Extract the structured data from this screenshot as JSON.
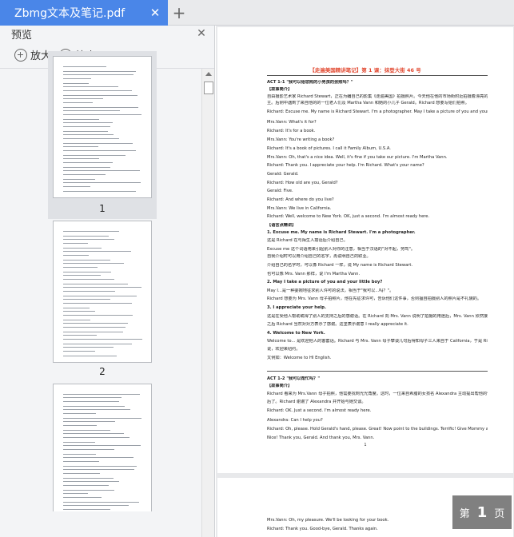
{
  "tab": {
    "title": "Zbmg文本及笔记.pdf",
    "close": "✕",
    "new": "+"
  },
  "panel": {
    "title": "预览",
    "close": "✕",
    "zoom_in": "放大",
    "zoom_out": "缩小"
  },
  "thumbnails": [
    {
      "number": "1"
    },
    {
      "number": "2"
    }
  ],
  "document": {
    "title": "【走遍美国精讲笔记】第 1 课：抹登大街 46 号",
    "page_number": "1",
    "lines": [
      {
        "text": "ACT 1-1 \"我可以给您照的小男孩的张照吗？\"",
        "style": "b"
      },
      {
        "text": "【故事简介】",
        "style": "b"
      },
      {
        "text": "自由摄影艺术家 Richard Stewart，正在为编自己的影集《走遍美国》拍摄照片。今天他在他的市场街附近拍摄着漂亮的建筑上主",
        "style": ""
      },
      {
        "text": "主。后刚中遇到了来自他的的一位老人们及 Martha Vann 和她的小儿子 Gerald。Richard 想要写给们拍照。",
        "style": ""
      },
      {
        "text": "Richard: Excuse me. My name is Richard Stewart. I'm a photographer. May I take a picture of you and your little boy?",
        "style": ""
      },
      {
        "text": "Mrs.Vann: What's it for?",
        "style": ""
      },
      {
        "text": "Richard: It's for a book.",
        "style": ""
      },
      {
        "text": "Mrs.Vann: You're writing a book?",
        "style": ""
      },
      {
        "text": "Richard: It's a book of pictures. I call it Family Album, U.S.A.",
        "style": ""
      },
      {
        "text": "Mrs.Vann: Oh, that's a nice idea. Well, it's fine if you take our picture. I'm Martha Vann.",
        "style": ""
      },
      {
        "text": "Richard: Thank you. I appreciate your help. I'm Richard. What's your name?",
        "style": ""
      },
      {
        "text": "Gerald: Gerald.",
        "style": ""
      },
      {
        "text": "Richard: How old are you, Gerald?",
        "style": ""
      },
      {
        "text": "Gerald: Five.",
        "style": ""
      },
      {
        "text": "Richard: And where do you live?",
        "style": ""
      },
      {
        "text": "Mrs.Vann: We live in California.",
        "style": ""
      },
      {
        "text": "Richard: Well, welcome to New York. OK, just a second. I'm almost ready here.",
        "style": ""
      },
      {
        "text": "【语言点精讲】",
        "style": "b"
      },
      {
        "text": "1. Excuse me. My name is Richard Stewart. I'm a photographer.",
        "style": "b"
      },
      {
        "text": "这是 Richard 在与陌生人搭话后介绍自己。",
        "style": ""
      },
      {
        "text": "Excuse me 这个词语用来引起别人对你的注意，相当于汉语的\"对不起，劳驾\"。",
        "style": ""
      },
      {
        "text": "自我介绍时可以用介绍自己的名字，再说明自己的职业。",
        "style": ""
      },
      {
        "text": "介绍自己的名字时，可以像 Richard 一样，说 My name is Richard Stewart.",
        "style": ""
      },
      {
        "text": "也可以像 Mrs. Vann 那样，说 I'm Martha Vann.",
        "style": ""
      },
      {
        "text": "2. May I take a picture of you and your little boy?",
        "style": "b"
      },
      {
        "text": "May I...是一种委婉地征求别人许可的说法，相当于\"我可以...吗？\"。",
        "style": ""
      },
      {
        "text": "Richard 想要为 Mrs. Vann 母子拍照片，他在先征求许可，告诉他们这件事，否则擅自拍摄别人的照片是不礼貌的。",
        "style": ""
      },
      {
        "text": "3. I appreciate your help.",
        "style": "b"
      },
      {
        "text": "这是在受他人帮助或得了别人的支持之后的感谢话。在 Richard 向 Mrs. Vann 说明了拍摄的用途后，Mrs. Vann 欣然接受拍照的请求。",
        "style": ""
      },
      {
        "text": "之后 Richard 当然对对方表示了感谢。这里表示谢意 I really appreciate it.",
        "style": ""
      },
      {
        "text": "4. Welcome to New York.",
        "style": "b"
      },
      {
        "text": "Welcome to... 是欢迎他人的客套话。Richard 与 Mrs. Vann 母子攀谈几句后得知母子三人来自于 California，于是 Richard 对他们",
        "style": ""
      },
      {
        "text": "说，欢迎来纽约。",
        "style": ""
      },
      {
        "text": "又例如：Welcome to HI English.",
        "style": ""
      },
      {
        "text": "ACT 1-2 \"我可以帮忙吗？\"",
        "style": "b"
      },
      {
        "text": "【故事简介】",
        "style": "b"
      },
      {
        "text": "Richard 看来为 Mrs.Vann 母子拍照，他需要找到光光角度。这时，一位来自希腊的女孩名 Alexandra 主动提出帮他的忙，拉计帮我们的完",
        "style": ""
      },
      {
        "text": "后了。Richard 谢谢了 Alexandra 并开始与她交谈。",
        "style": ""
      },
      {
        "text": "Richard: OK. Just a second. I'm almost ready here.",
        "style": ""
      },
      {
        "text": "Alexandra: Can I help you?",
        "style": ""
      },
      {
        "text": "Richard: Oh, please. Hold Gerald's hand, please. Great! Now point to the buildings. Terrific! Give Mommy a kiss, Gerald.",
        "style": ""
      },
      {
        "text": "Nice! Thank you, Gerald. And thank you, Mrs. Vann.",
        "style": ""
      }
    ],
    "page2_lines": [
      "Mrs.Vann: Oh, my pleasure. We'll be looking for your book.",
      "Richard: Thank you. Good-bye, Gerald. Thanks again."
    ]
  },
  "page_badge": {
    "prefix": "第",
    "number": "1",
    "suffix": "页"
  }
}
